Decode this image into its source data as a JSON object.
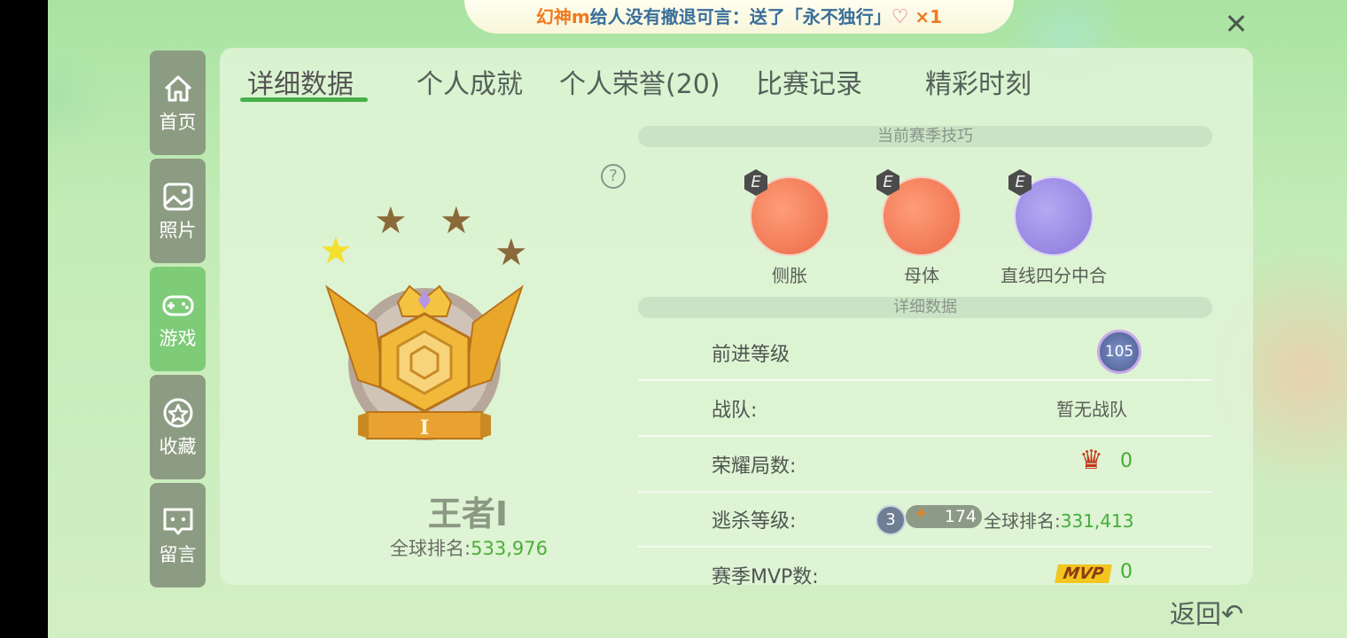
{
  "banner": {
    "sender": "幻神m",
    "message_part1": "给人没有撤退可言：",
    "message_part2": "送了「永不独行」",
    "count": "×1"
  },
  "nav": {
    "home": "首页",
    "photos": "照片",
    "games": "游戏",
    "favorites": "收藏",
    "messages": "留言"
  },
  "tabs": {
    "details": "详细数据",
    "achievements": "个人成就",
    "honors": "个人荣誉(20)",
    "matches": "比赛记录",
    "highlights": "精彩时刻"
  },
  "rank": {
    "name": "王者Ⅰ",
    "global_label": "全球排名:",
    "global_value": "533,976",
    "tier_numeral": "I",
    "stars_filled": 1,
    "stars_total": 4
  },
  "help_icon": "?",
  "skills_section": {
    "title": "当前赛季技巧",
    "items": [
      {
        "label": "侧胀",
        "badge": "E",
        "color": "#f07b55"
      },
      {
        "label": "母体",
        "badge": "E",
        "color": "#f07b55"
      },
      {
        "label": "直线四分中合",
        "badge": "E",
        "color": "#9a8ae6"
      }
    ]
  },
  "details_section": {
    "title": "详细数据",
    "advance_level_label": "前进等级",
    "advance_level_value": "105",
    "team_label": "战队:",
    "team_value": "暂无战队",
    "glory_label": "荣耀局数:",
    "glory_value": "0",
    "escape_label": "逃杀等级:",
    "escape_level": "3",
    "escape_points": "174",
    "escape_rank_label": "全球排名:",
    "escape_rank_value": "331,413",
    "mvp_label": "赛季MVP数:",
    "mvp_badge": "MVP",
    "mvp_value": "0"
  },
  "back": "返回"
}
